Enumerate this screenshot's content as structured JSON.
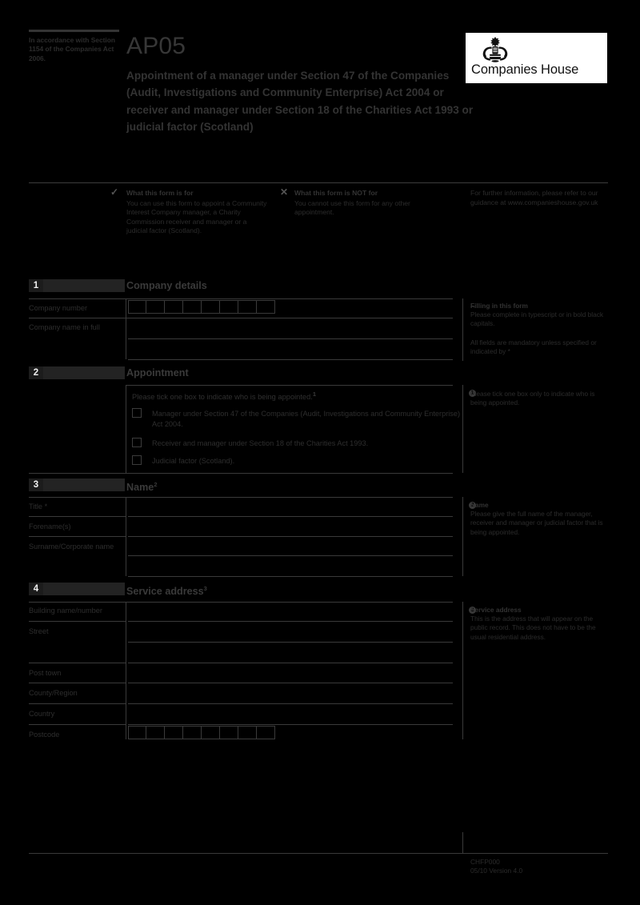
{
  "header": {
    "accordance": "In accordance with Section 1154 of the Companies Act 2006.",
    "form_code": "AP05",
    "form_title": "Appointment of a manager under Section 47 of the Companies (Audit, Investigations and Community Enterprise) Act 2004 or receiver and manager under Section 18 of the Charities Act 1993 or judicial factor (Scotland)",
    "logo_text": "Companies House",
    "logo_crest_name": "royal-coat-of-arms"
  },
  "info": {
    "for_icon": "tick-icon",
    "for_heading": "What this form is for",
    "for_body": "You can use this form to appoint a Community Interest Company manager, a Charity Commission receiver and manager or a judicial factor (Scotland).",
    "not_for_icon": "cross-icon",
    "not_for_heading": "What this form is NOT for",
    "not_for_body": "You cannot use this form for any other appointment.",
    "further_body": "For further information, please refer to our guidance at www.companieshouse.gov.uk"
  },
  "sections": {
    "s1": {
      "number": "1",
      "title": "Company details",
      "company_number_label": "Company number",
      "company_number_boxes": 8,
      "company_name_label": "Company name in full",
      "company_number_value": "",
      "company_name_value": ""
    },
    "s2": {
      "number": "2",
      "title": "Appointment",
      "intro": "Please tick one box to indicate who is being appointed.",
      "intro_ref": "1",
      "options": [
        "Manager under Section 47 of the Companies (Audit, Investigations and Community Enterprise) Act 2004.",
        "Receiver and manager under Section 18 of the Charities Act 1993.",
        "Judicial factor (Scotland)."
      ]
    },
    "s3": {
      "number": "3",
      "title": "Name",
      "title_ref": "2",
      "fields": [
        {
          "label": "Title *",
          "value": ""
        },
        {
          "label": "Forename(s)",
          "value": ""
        },
        {
          "label": "Surname/Corporate name",
          "value": ""
        }
      ]
    },
    "s4": {
      "number": "4",
      "title": "Service address",
      "title_ref": "3",
      "fields": [
        {
          "label": "Building name/number",
          "value": ""
        },
        {
          "label": "Street",
          "value": ""
        },
        {
          "label": "Post town",
          "value": ""
        },
        {
          "label": "County/Region",
          "value": ""
        },
        {
          "label": "Country",
          "value": ""
        }
      ],
      "postcode_label": "Postcode",
      "postcode_boxes": 8,
      "postcode_value": ""
    }
  },
  "notes": {
    "filling": {
      "marker": "→",
      "heading": "Filling in this form",
      "body1": "Please complete in typescript or in bold black capitals.",
      "body2": "All fields are mandatory unless specified or indicated by *"
    },
    "n1": {
      "marker": "1",
      "body": "Please tick one box only to indicate who is being appointed."
    },
    "n2": {
      "marker": "2",
      "heading": "Name",
      "body": "Please give the full name of the manager, receiver and manager or judicial factor that is being appointed."
    },
    "n3": {
      "marker": "3",
      "heading": "Service address",
      "body": "This is the address that will appear on the public record. This does not have to be the usual residential address."
    }
  },
  "footer": {
    "code": "CHFP000",
    "version": "05/10 Version 4.0"
  }
}
